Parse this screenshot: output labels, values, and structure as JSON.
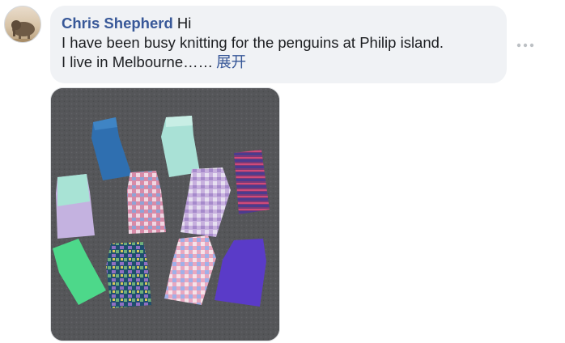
{
  "comment": {
    "author": "Chris Shepherd",
    "line1_text": "Hi",
    "line2_text": "I have been busy knitting for the penguins at Philip island.",
    "line3_text": "I live in Melbourne……",
    "expand_label": "展开"
  },
  "icons": {
    "avatar": "elephant-avatar",
    "more": "more-options-icon"
  },
  "colors": {
    "author": "#385898",
    "bubble": "#f0f2f5",
    "text": "#1c1e21",
    "carpet": "#56575a"
  },
  "photo": {
    "content": "knitted penguin jumpers on carpet"
  }
}
